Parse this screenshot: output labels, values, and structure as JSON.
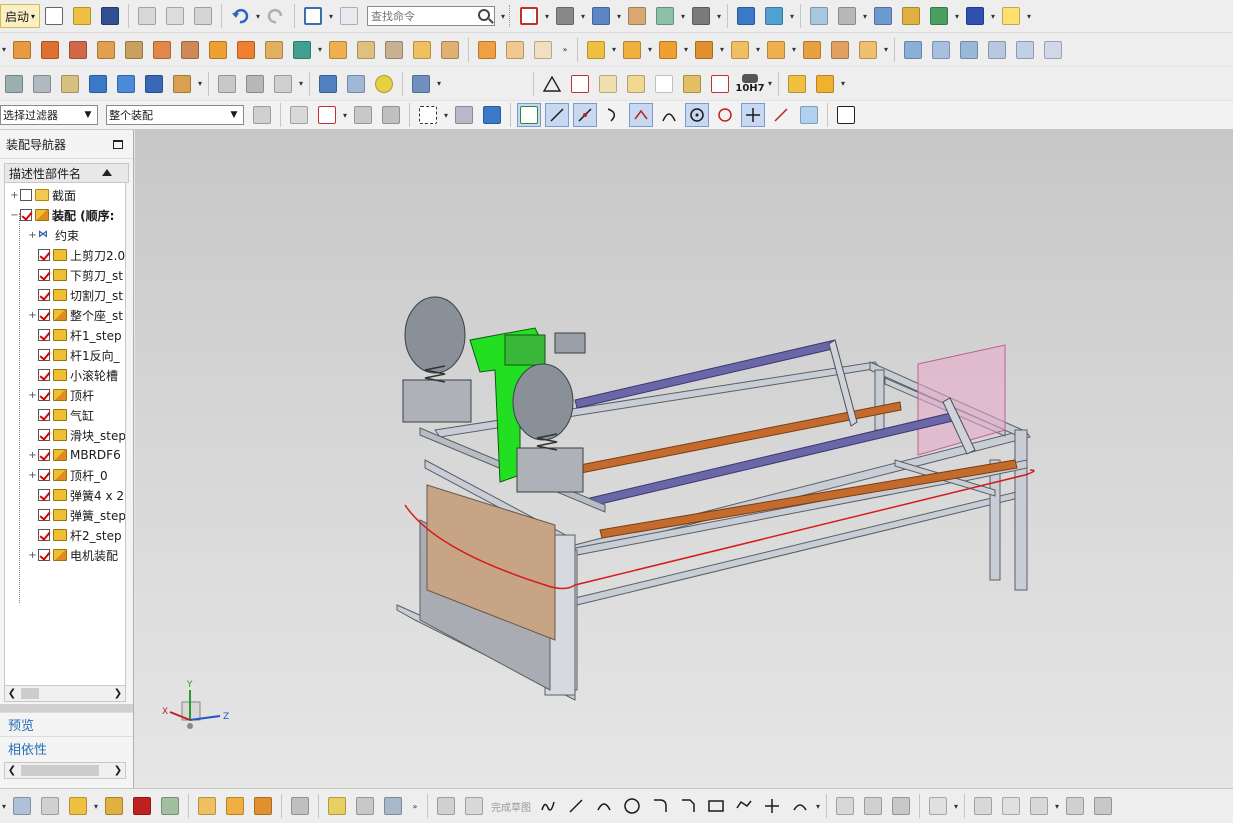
{
  "toolbar": {
    "start_label": "启动",
    "search_placeholder": "查找命令",
    "selection_filter": "选择过滤器",
    "assembly_scope": "整个装配",
    "fit_tolerance_label": "10H7",
    "finish_sketch_label": "完成草图"
  },
  "navigator": {
    "title": "装配导航器",
    "column_header": "描述性部件名",
    "items": [
      {
        "label": "截面",
        "type": "folder",
        "checked": false,
        "expander": "+",
        "level": 0
      },
      {
        "label": "装配 (顺序:",
        "type": "asm",
        "checked": true,
        "expander": "−",
        "level": 0
      },
      {
        "label": "约束",
        "type": "constraint",
        "checked": null,
        "expander": "+",
        "level": 1
      },
      {
        "label": "上剪刀2.0",
        "type": "part",
        "checked": true,
        "expander": "",
        "level": 1
      },
      {
        "label": "下剪刀_st",
        "type": "part",
        "checked": true,
        "expander": "",
        "level": 1
      },
      {
        "label": "切割刀_st",
        "type": "part",
        "checked": true,
        "expander": "",
        "level": 1
      },
      {
        "label": "整个座_st",
        "type": "asm",
        "checked": true,
        "expander": "+",
        "level": 1
      },
      {
        "label": "杆1_step",
        "type": "part",
        "checked": true,
        "expander": "",
        "level": 1
      },
      {
        "label": "杆1反向_",
        "type": "part",
        "checked": true,
        "expander": "",
        "level": 1
      },
      {
        "label": "小滚轮槽",
        "type": "part",
        "checked": true,
        "expander": "",
        "level": 1
      },
      {
        "label": "顶杆",
        "type": "asm",
        "checked": true,
        "expander": "+",
        "level": 1
      },
      {
        "label": "气缸",
        "type": "part",
        "checked": true,
        "expander": "",
        "level": 1
      },
      {
        "label": "滑块_step",
        "type": "part",
        "checked": true,
        "expander": "",
        "level": 1
      },
      {
        "label": "MBRDF6",
        "type": "asm",
        "checked": true,
        "expander": "+",
        "level": 1
      },
      {
        "label": "顶杆_0",
        "type": "asm",
        "checked": true,
        "expander": "+",
        "level": 1
      },
      {
        "label": "弹簧4 x 2",
        "type": "part",
        "checked": true,
        "expander": "",
        "level": 1
      },
      {
        "label": "弹簧_step",
        "type": "part",
        "checked": true,
        "expander": "",
        "level": 1
      },
      {
        "label": "杆2_step",
        "type": "part",
        "checked": true,
        "expander": "",
        "level": 1
      },
      {
        "label": "电机装配",
        "type": "asm",
        "checked": true,
        "expander": "+",
        "level": 1
      }
    ],
    "preview_label": "预览",
    "dependency_label": "相依性"
  },
  "triad": {
    "x": "X",
    "y": "Y",
    "z": "Z"
  },
  "colors": {
    "frame": "#c9ced6",
    "frame_edge": "#5a5f66",
    "motor_green": "#22e021",
    "rod_purple": "#6a67a8",
    "rail_orange": "#c46a2c",
    "red_cable": "#d41c1c",
    "pink_plate": "#e8a8c8",
    "tan_plate": "#c8a486"
  }
}
